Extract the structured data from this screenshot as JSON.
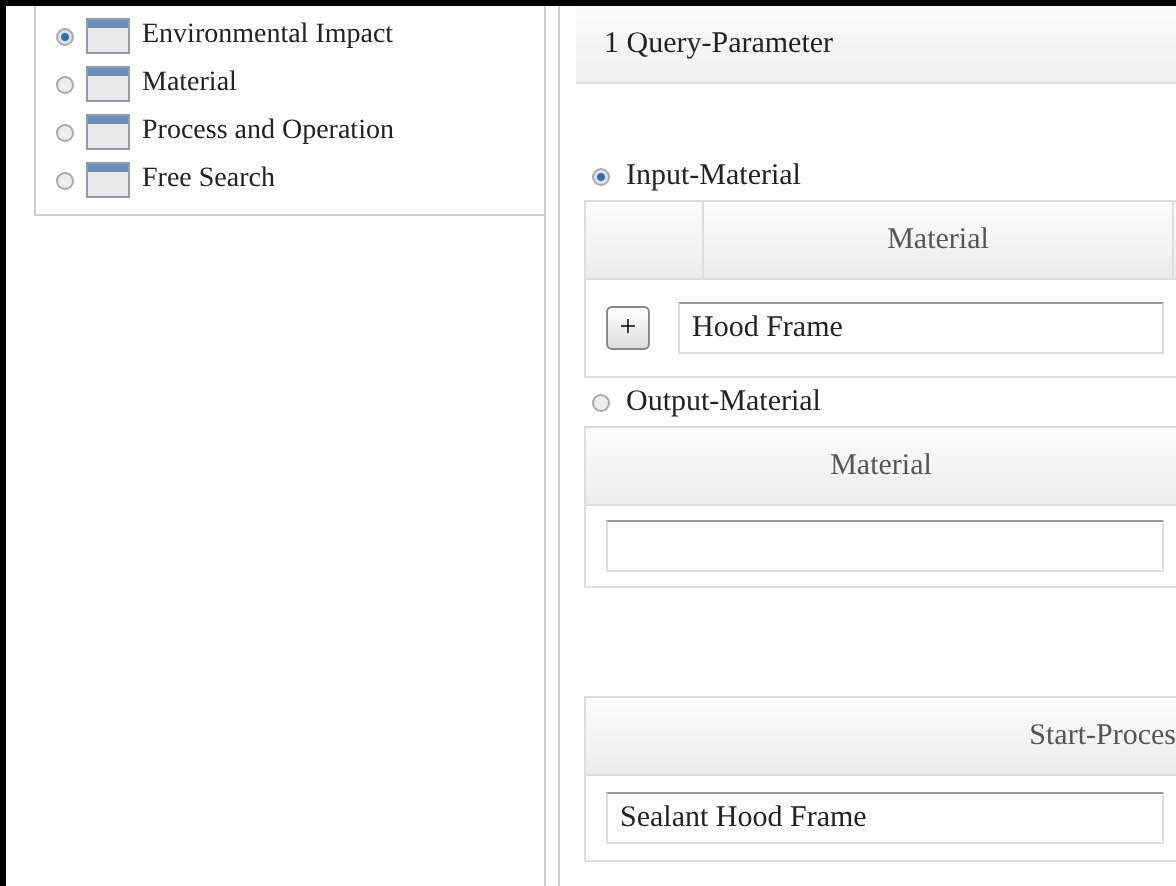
{
  "sidebar": {
    "items": [
      {
        "label": "Environmental Impact",
        "selected": true
      },
      {
        "label": "Material",
        "selected": false
      },
      {
        "label": "Process and Operation",
        "selected": false
      },
      {
        "label": "Free Search",
        "selected": false
      }
    ]
  },
  "panel": {
    "title": "1 Query-Parameter",
    "input": {
      "label": "Input-Material",
      "selected": true,
      "column": "Material",
      "add": "+",
      "value": "Hood Frame"
    },
    "output": {
      "label": "Output-Material",
      "selected": false,
      "column": "Material"
    },
    "process": {
      "column": "Start-Proces",
      "value": "Sealant Hood Frame"
    }
  }
}
